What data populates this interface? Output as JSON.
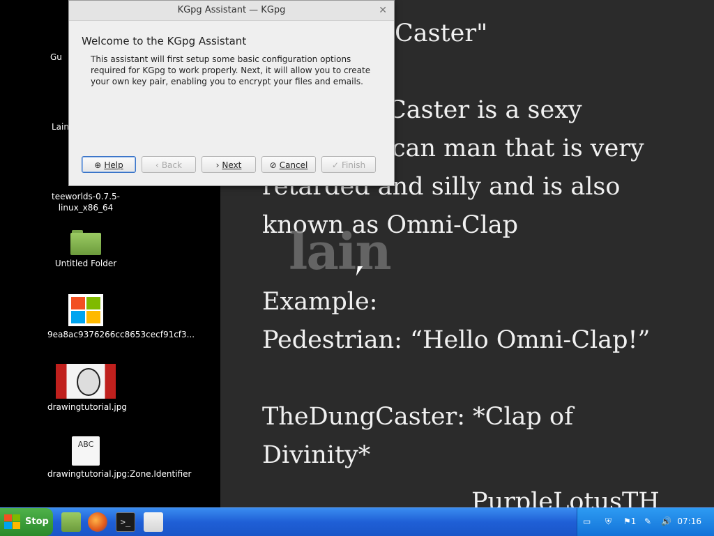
{
  "desktop": {
    "icons": [
      {
        "label": "Gu",
        "type": "partial"
      },
      {
        "label": "Lain",
        "type": "partial"
      },
      {
        "label": "teeworlds-0.7.5-linux_x86_64",
        "type": "file"
      },
      {
        "label": "Untitled Folder",
        "type": "folder"
      },
      {
        "label": "9ea8ac9376266cc8653cecf91cf3...",
        "type": "image"
      },
      {
        "label": "drawingtutorial.jpg",
        "type": "image"
      },
      {
        "label": "drawingtutorial.jpg:Zone.Identifier",
        "type": "text"
      }
    ]
  },
  "document": {
    "lines": [
      "Caster\"",
      "Caster is a sexy",
      "can man that is very",
      "retarded and silly and is also",
      "known as Omni-Clap",
      "Example:",
      "Pedestrian: “Hello Omni-Clap!”",
      "TheDungCaster: *Clap of",
      "Divinity*",
      "PurpleLotusTH"
    ],
    "watermark": "lain"
  },
  "dialog": {
    "title": "KGpg Assistant — KGpg",
    "heading": "Welcome to the KGpg Assistant",
    "body": "This assistant will first setup some basic configuration options required for KGpg to work properly. Next, it will allow you to create your own key pair, enabling you to encrypt your files and emails.",
    "buttons": {
      "help": "Help",
      "back": "Back",
      "next": "Next",
      "cancel": "Cancel",
      "finish": "Finish"
    }
  },
  "taskbar": {
    "start_label": "Stop",
    "tray_badge": "1",
    "clock": "07:16"
  }
}
